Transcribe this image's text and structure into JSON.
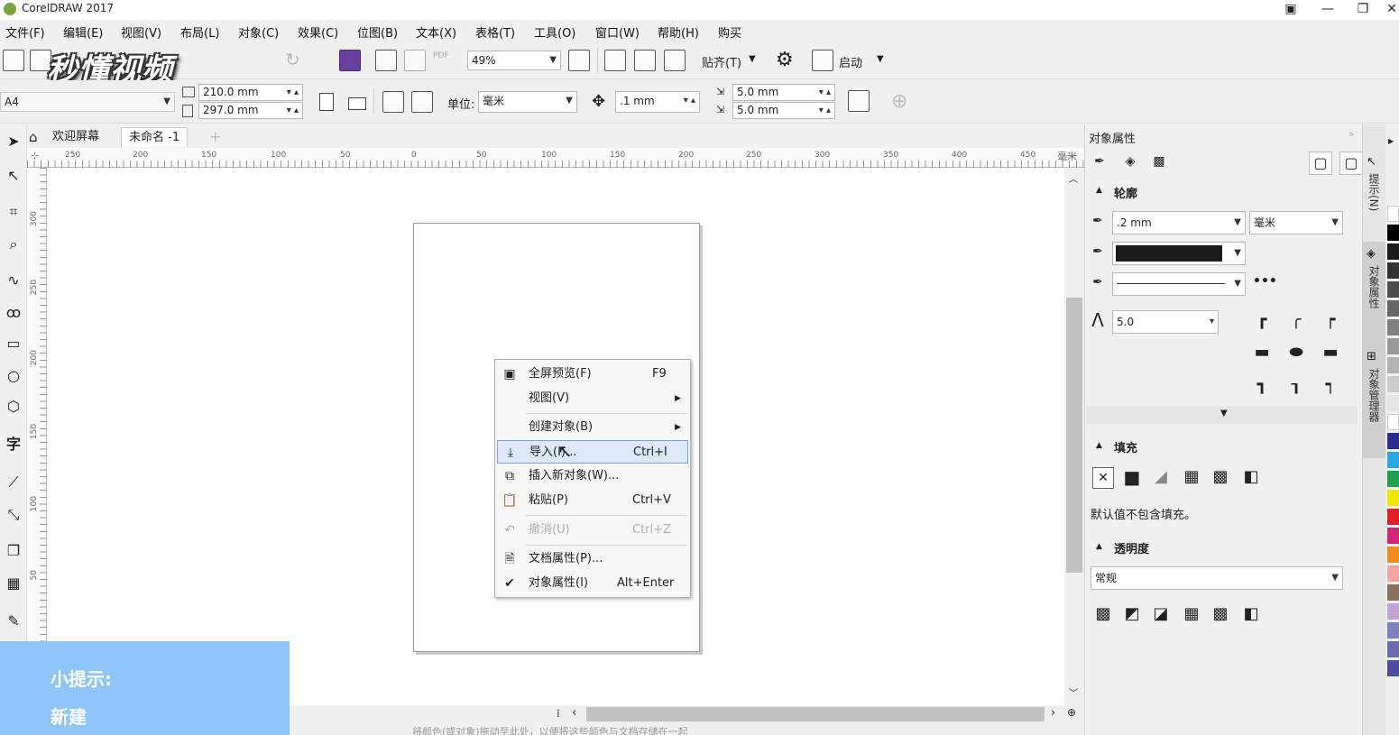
{
  "app": {
    "title": "CorelDRAW 2017",
    "win_min": "—",
    "win_max": "❐",
    "win_close": "✕"
  },
  "menu": [
    "文件(F)",
    "编辑(E)",
    "视图(V)",
    "布局(L)",
    "对象(C)",
    "效果(C)",
    "位图(B)",
    "文本(X)",
    "表格(T)",
    "工具(O)",
    "窗口(W)",
    "帮助(H)",
    "购买"
  ],
  "watermark": "秒懂视频",
  "toolbar1": {
    "zoom": "49%",
    "snap_label": "贴齐(T)",
    "launch_label": "启动"
  },
  "toolbar2": {
    "page_size": "A4",
    "width": "210.0 mm",
    "height": "297.0 mm",
    "unit_label": "单位:",
    "unit_value": "毫米",
    "nudge": ".1 mm",
    "dup_x": "5.0 mm",
    "dup_y": "5.0 mm"
  },
  "tabs": {
    "welcome": "欢迎屏幕",
    "doc": "未命名 -1",
    "add": "+"
  },
  "ruler": {
    "h_ticks": [
      "250",
      "200",
      "150",
      "100",
      "50",
      "0",
      "50",
      "100",
      "150",
      "200",
      "250",
      "300",
      "350",
      "400",
      "450"
    ],
    "h_unit": "毫米",
    "v_ticks": [
      "300",
      "250",
      "200",
      "150",
      "100",
      "50"
    ]
  },
  "context_menu": {
    "items": [
      {
        "icon": "fullscreen-icon",
        "label": "全屏预览(F)",
        "shortcut": "F9",
        "submenu": false,
        "disabled": false
      },
      {
        "icon": "",
        "label": "视图(V)",
        "shortcut": "",
        "submenu": true,
        "disabled": false
      },
      {
        "icon": "",
        "label": "创建对象(B)",
        "shortcut": "",
        "submenu": true,
        "disabled": false
      },
      {
        "icon": "import-icon",
        "label": "导入(I)...",
        "shortcut": "Ctrl+I",
        "submenu": false,
        "disabled": false,
        "highlighted": true
      },
      {
        "icon": "insert-object-icon",
        "label": "插入新对象(W)...",
        "shortcut": "",
        "submenu": false,
        "disabled": false
      },
      {
        "icon": "paste-icon",
        "label": "粘贴(P)",
        "shortcut": "Ctrl+V",
        "submenu": false,
        "disabled": false
      },
      {
        "icon": "undo-icon",
        "label": "撤消(U)",
        "shortcut": "Ctrl+Z",
        "submenu": false,
        "disabled": true
      },
      {
        "icon": "doc-properties-icon",
        "label": "文档属性(P)...",
        "shortcut": "",
        "submenu": false,
        "disabled": false
      },
      {
        "icon": "check-icon",
        "label": "对象属性(I)",
        "shortcut": "Alt+Enter",
        "submenu": false,
        "disabled": false
      }
    ]
  },
  "tip": {
    "title": "小提示:",
    "body": "新建"
  },
  "docker": {
    "title": "对象属性",
    "outline_head": "轮廓",
    "outline_width": ".2 mm",
    "outline_unit": "毫米",
    "outline_color": "#1a1a1a",
    "miter": "5.0",
    "fill_head": "填充",
    "fill_note": "默认值不包含填充。",
    "transparency_head": "透明度",
    "transparency_mode": "常规"
  },
  "side_tabs": [
    "提示(N)",
    "对象属性",
    "对象管理器"
  ],
  "palette": [
    "#ffffff",
    "#000000",
    "#1a1a1a",
    "#333333",
    "#4d4d4d",
    "#666666",
    "#808080",
    "#999999",
    "#b3b3b3",
    "#cccccc",
    "#e6e6e6",
    "#ffffff",
    "#2b2b8c",
    "#29a8e0",
    "#1ea14a",
    "#f2e600",
    "#e31e24",
    "#d4237a",
    "#f08c1a",
    "#f5a3a3",
    "#8a6d5a",
    "#c2a3d6",
    "#8080c0",
    "#6a6ab0",
    "#4d4d9c"
  ],
  "statusbar": "将颜色(或对象)拖动至此处，以便将这些颜色与文档存储在一起"
}
